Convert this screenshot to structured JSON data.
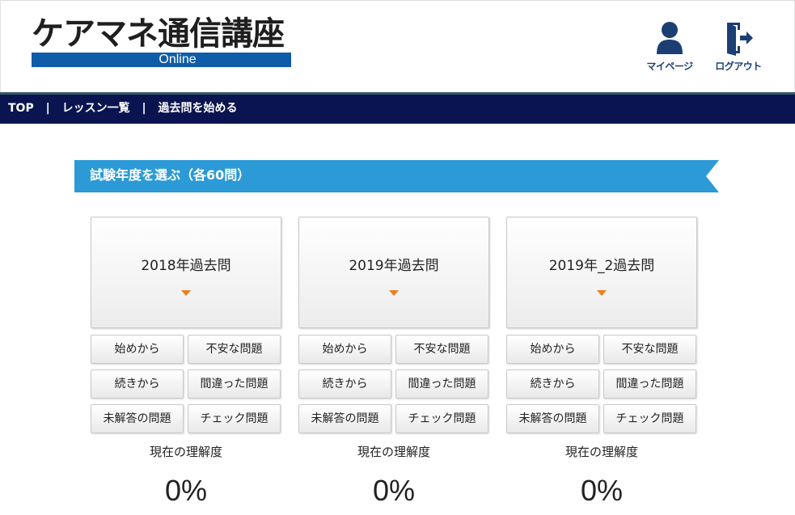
{
  "header": {
    "logo_title": "ケアマネ通信講座",
    "logo_subtitle": "Online",
    "mypage_label": "マイページ",
    "logout_label": "ログアウト"
  },
  "nav": {
    "items": [
      "TOP",
      "レッスン一覧",
      "過去問を始める"
    ],
    "separator": "|"
  },
  "section": {
    "title": "試験年度を選ぶ（各60問）"
  },
  "years": [
    {
      "title": "2018年過去問",
      "buttons": [
        "始めから",
        "不安な問題",
        "続きから",
        "間違った問題",
        "未解答の問題",
        "チェック問題"
      ],
      "understanding_label": "現在の理解度",
      "understanding_value": "0%"
    },
    {
      "title": "2019年過去問",
      "buttons": [
        "始めから",
        "不安な問題",
        "続きから",
        "間違った問題",
        "未解答の問題",
        "チェック問題"
      ],
      "understanding_label": "現在の理解度",
      "understanding_value": "0%"
    },
    {
      "title": "2019年_2過去問",
      "buttons": [
        "始めから",
        "不安な問題",
        "続きから",
        "間違った問題",
        "未解答の問題",
        "チェック問題"
      ],
      "understanding_label": "現在の理解度",
      "understanding_value": "0%"
    }
  ],
  "colors": {
    "nav_bg": "#0a1450",
    "ribbon": "#2b9ad6",
    "logo_bar": "#0f5ca8",
    "icon": "#1b3f73",
    "arrow": "#ef7d1a"
  },
  "icons": {
    "mypage": "user-icon",
    "logout": "logout-door-icon",
    "year_expand": "caret-down-icon"
  }
}
